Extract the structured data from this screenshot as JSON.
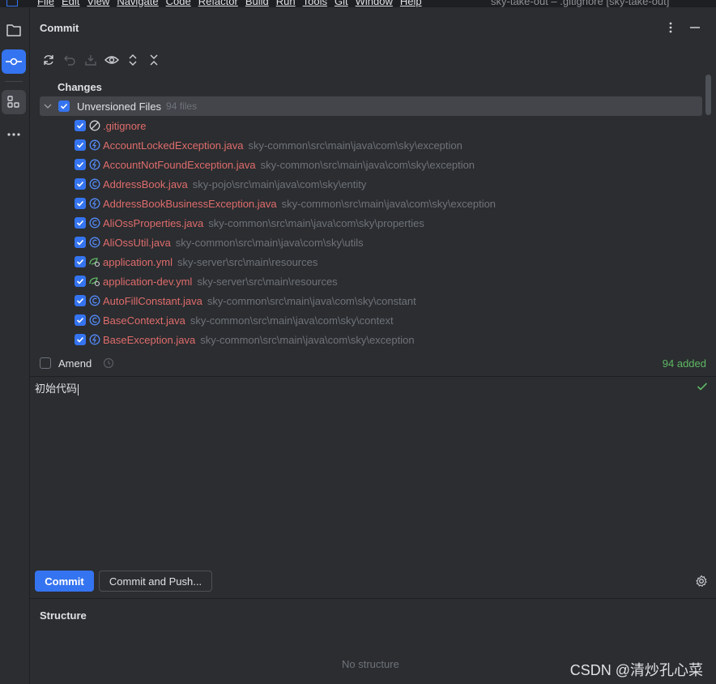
{
  "menu": {
    "items": [
      "File",
      "Edit",
      "View",
      "Navigate",
      "Code",
      "Refactor",
      "Build",
      "Run",
      "Tools",
      "Git",
      "Window",
      "Help"
    ],
    "window_title": "sky-take-out – .gitignore [sky-take-out]"
  },
  "toolstrip": {
    "items": [
      "project-icon",
      "commit-icon",
      "structure-icon",
      "more-icon"
    ]
  },
  "commit_panel": {
    "title": "Commit",
    "toolbar": [
      "refresh-icon",
      "rollback-icon",
      "shelve-icon",
      "show-diff-icon",
      "expand-all-icon",
      "collapse-all-icon"
    ],
    "changes_title": "Changes",
    "group": {
      "label": "Unversioned Files",
      "count": "94 files"
    },
    "files": [
      {
        "name": ".gitignore",
        "path": "",
        "icon": "ignore-icon"
      },
      {
        "name": "AccountLockedException.java",
        "path": "sky-common\\src\\main\\java\\com\\sky\\exception",
        "icon": "exception-class-icon"
      },
      {
        "name": "AccountNotFoundException.java",
        "path": "sky-common\\src\\main\\java\\com\\sky\\exception",
        "icon": "exception-class-icon"
      },
      {
        "name": "AddressBook.java",
        "path": "sky-pojo\\src\\main\\java\\com\\sky\\entity",
        "icon": "class-icon"
      },
      {
        "name": "AddressBookBusinessException.java",
        "path": "sky-common\\src\\main\\java\\com\\sky\\exception",
        "icon": "exception-class-icon"
      },
      {
        "name": "AliOssProperties.java",
        "path": "sky-common\\src\\main\\java\\com\\sky\\properties",
        "icon": "class-icon"
      },
      {
        "name": "AliOssUtil.java",
        "path": "sky-common\\src\\main\\java\\com\\sky\\utils",
        "icon": "class-icon"
      },
      {
        "name": "application.yml",
        "path": "sky-server\\src\\main\\resources",
        "icon": "spring-config-icon"
      },
      {
        "name": "application-dev.yml",
        "path": "sky-server\\src\\main\\resources",
        "icon": "spring-config-icon"
      },
      {
        "name": "AutoFillConstant.java",
        "path": "sky-common\\src\\main\\java\\com\\sky\\constant",
        "icon": "class-icon"
      },
      {
        "name": "BaseContext.java",
        "path": "sky-common\\src\\main\\java\\com\\sky\\context",
        "icon": "class-icon"
      },
      {
        "name": "BaseException.java",
        "path": "sky-common\\src\\main\\java\\com\\sky\\exception",
        "icon": "exception-class-icon"
      }
    ],
    "amend_label": "Amend",
    "added_status": "94 added",
    "message": "初始代码",
    "commit_button": "Commit",
    "commit_push_button": "Commit and Push..."
  },
  "structure_panel": {
    "title": "Structure",
    "empty_text": "No structure"
  },
  "watermark": "CSDN @清炒孔心菜",
  "colors": {
    "accent": "#3574f0",
    "unversioned_file": "#e06c6c",
    "success": "#5fb865",
    "background": "#2b2d30"
  }
}
